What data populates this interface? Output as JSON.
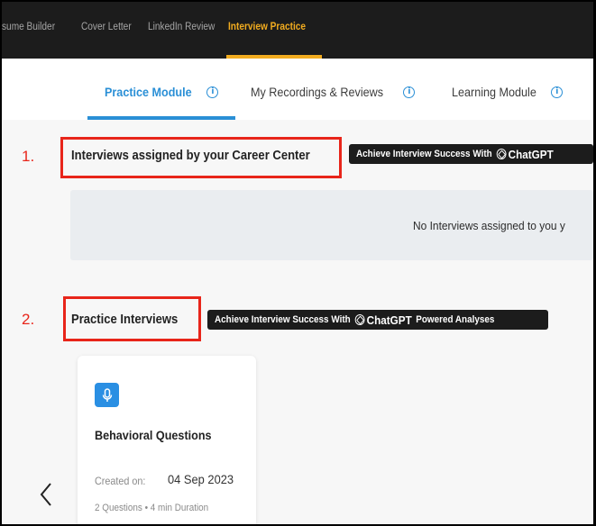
{
  "topnav": {
    "links": [
      {
        "label": "sume Builder"
      },
      {
        "label": "Cover Letter"
      },
      {
        "label": "LinkedIn Review"
      },
      {
        "label": "Interview Practice"
      }
    ],
    "active_color": "#f2ac1f"
  },
  "tabs": [
    {
      "label": "Practice Module",
      "active": true
    },
    {
      "label": "My Recordings & Reviews",
      "active": false
    },
    {
      "label": "Learning Module",
      "active": false
    }
  ],
  "info_glyph": "i",
  "sections": {
    "assigned": {
      "number": "1.",
      "title": "Interviews assigned by your Career Center",
      "badge_prefix": "Achieve Interview Success With",
      "badge_brand": "ChatGPT",
      "badge_suffix": "",
      "empty_message": "No Interviews assigned to you y"
    },
    "practice": {
      "number": "2.",
      "title": "Practice Interviews",
      "badge_prefix": "Achieve Interview Success With",
      "badge_brand": "ChatGPT",
      "badge_suffix": "Powered Analyses"
    }
  },
  "card": {
    "icon": "microphone-icon",
    "title": "Behavioral Questions",
    "created_label": "Created on:",
    "created_date": "04 Sep 2023",
    "details": "2 Questions • 4 min Duration"
  },
  "colors": {
    "accent_blue": "#2a8fd6",
    "highlight_red": "#e8251a",
    "nav_dark": "#1c1c1c"
  }
}
